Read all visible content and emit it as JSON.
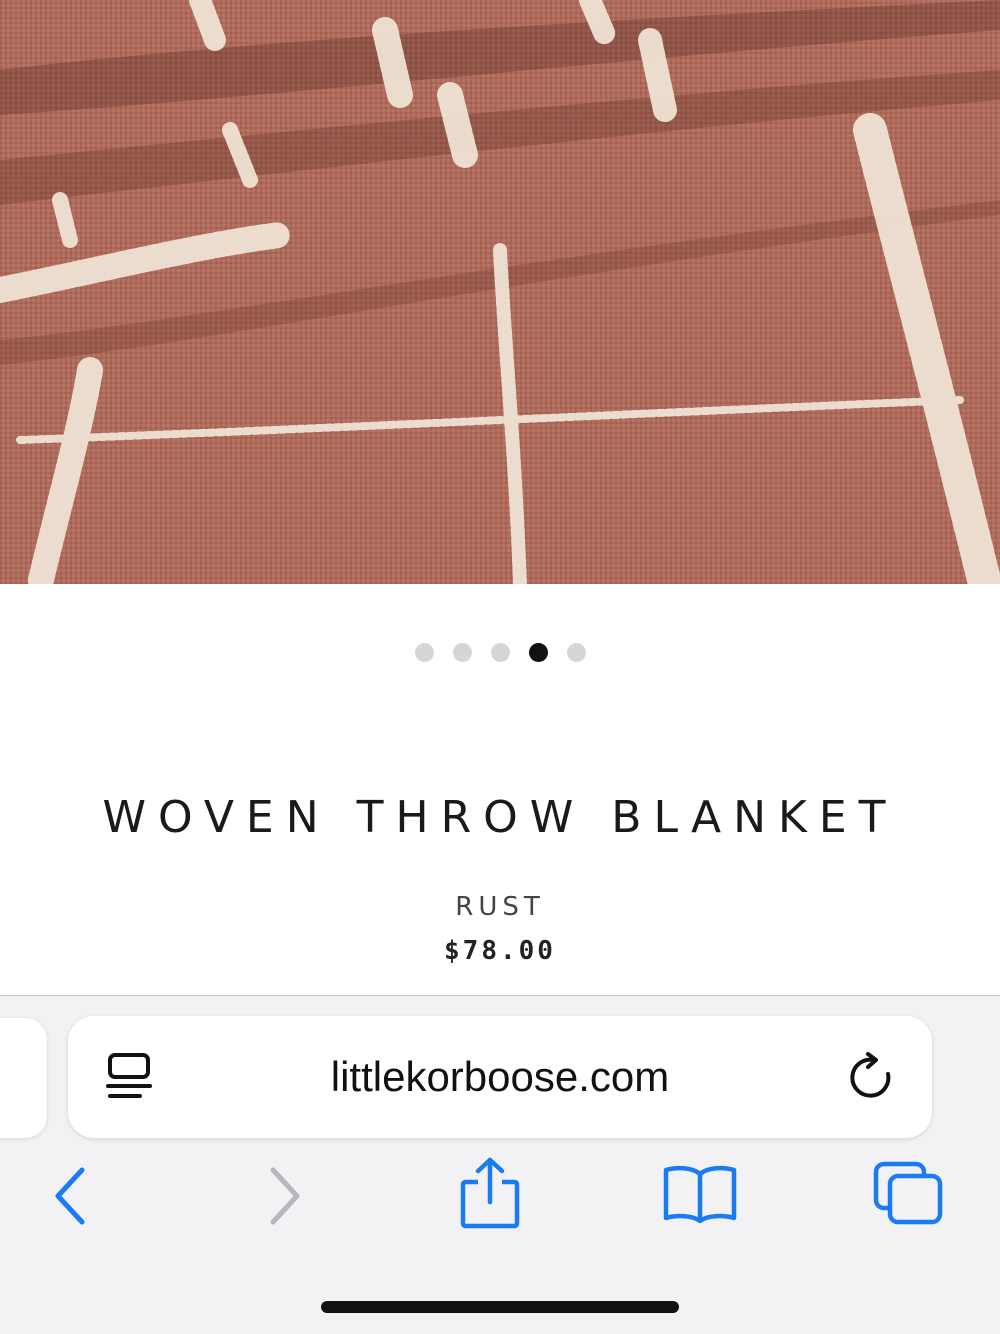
{
  "product": {
    "title": "WOVEN THROW BLANKET",
    "variant": "RUST",
    "price": "$78.00"
  },
  "carousel": {
    "total_images": 5,
    "active_index": 3
  },
  "browser": {
    "url": "littlekorboose.com",
    "icons": [
      "reader-mode-icon",
      "reload-icon",
      "back-icon",
      "forward-icon",
      "share-icon",
      "bookmarks-icon",
      "tabs-icon"
    ]
  },
  "colors": {
    "accent": "#1a7cf5",
    "disabled": "#b8b8bc",
    "fabric": "#b36a5a"
  }
}
